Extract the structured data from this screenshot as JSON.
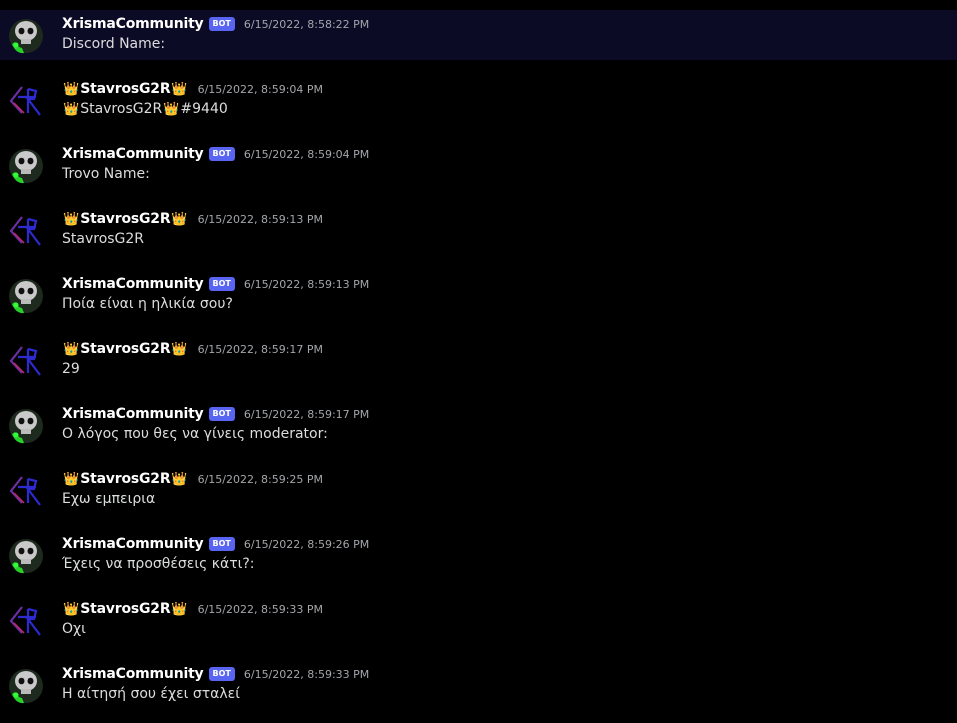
{
  "colors": {
    "background": "#000000",
    "highlight_row": "#0b0b26",
    "bot_badge": "#5865f2",
    "username": "#ffffff",
    "timestamp": "#a3a6aa",
    "message_text": "#dcddde"
  },
  "messages": [
    {
      "author": "XrismaCommunity",
      "bot_badge": "BOT",
      "timestamp": "6/15/2022, 8:58:22 PM",
      "text": "Discord Name:"
    },
    {
      "author": "StavrosG2R",
      "timestamp": "6/15/2022, 8:59:04 PM",
      "text_prefix": "StavrosG2R",
      "text_suffix": "#9440"
    },
    {
      "author": "XrismaCommunity",
      "bot_badge": "BOT",
      "timestamp": "6/15/2022, 8:59:04 PM",
      "text": "Trovo Name:"
    },
    {
      "author": "StavrosG2R",
      "timestamp": "6/15/2022, 8:59:13 PM",
      "text": "StavrosG2R"
    },
    {
      "author": "XrismaCommunity",
      "bot_badge": "BOT",
      "timestamp": "6/15/2022, 8:59:13 PM",
      "text": "Ποία είναι η ηλικία σου?"
    },
    {
      "author": "StavrosG2R",
      "timestamp": "6/15/2022, 8:59:17 PM",
      "text": "29"
    },
    {
      "author": "XrismaCommunity",
      "bot_badge": "BOT",
      "timestamp": "6/15/2022, 8:59:17 PM",
      "text": "Ο λόγος που θες να γίνεις moderator:"
    },
    {
      "author": "StavrosG2R",
      "timestamp": "6/15/2022, 8:59:25 PM",
      "text": "Εχω εμπειρια"
    },
    {
      "author": "XrismaCommunity",
      "bot_badge": "BOT",
      "timestamp": "6/15/2022, 8:59:26 PM",
      "text": "Έχεις να προσθέσεις κάτι?:"
    },
    {
      "author": "StavrosG2R",
      "timestamp": "6/15/2022, 8:59:33 PM",
      "text": "Οχι"
    },
    {
      "author": "XrismaCommunity",
      "bot_badge": "BOT",
      "timestamp": "6/15/2022, 8:59:33 PM",
      "text": "Η αίτησή σου έχει σταλεί"
    }
  ]
}
